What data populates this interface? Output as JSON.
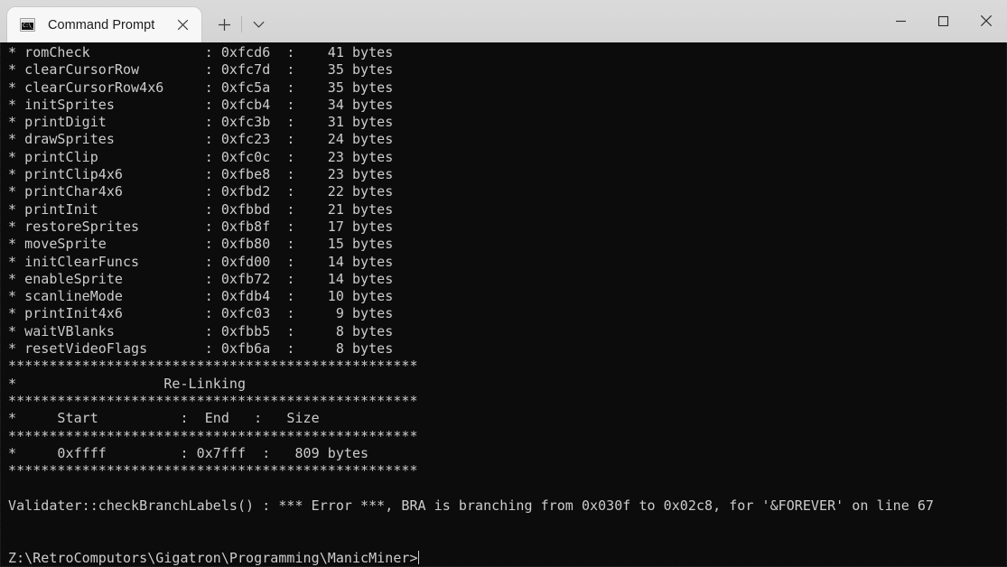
{
  "window": {
    "title": "Command Prompt",
    "controls": {
      "minimize_label": "Minimize",
      "maximize_label": "Maximize",
      "close_label": "Close"
    }
  },
  "tabbar": {
    "tabs": [
      {
        "label": "Command Prompt",
        "icon": "command-prompt-icon",
        "icon_text": "C:\\_",
        "close_label": "Close tab"
      }
    ],
    "new_tab_label": "+",
    "dropdown_label": "Open new tab dropdown"
  },
  "terminal": {
    "background": "#0c0c0c",
    "foreground": "#cccccc",
    "lines": [
      "* romCheck              : 0xfcd6  :    41 bytes",
      "* clearCursorRow        : 0xfc7d  :    35 bytes",
      "* clearCursorRow4x6     : 0xfc5a  :    35 bytes",
      "* initSprites           : 0xfcb4  :    34 bytes",
      "* printDigit            : 0xfc3b  :    31 bytes",
      "* drawSprites           : 0xfc23  :    24 bytes",
      "* printClip             : 0xfc0c  :    23 bytes",
      "* printClip4x6          : 0xfbe8  :    23 bytes",
      "* printChar4x6          : 0xfbd2  :    22 bytes",
      "* printInit             : 0xfbbd  :    21 bytes",
      "* restoreSprites        : 0xfb8f  :    17 bytes",
      "* moveSprite            : 0xfb80  :    15 bytes",
      "* initClearFuncs        : 0xfd00  :    14 bytes",
      "* enableSprite          : 0xfb72  :    14 bytes",
      "* scanlineMode          : 0xfdb4  :    10 bytes",
      "* printInit4x6          : 0xfc03  :     9 bytes",
      "* waitVBlanks           : 0xfbb5  :     8 bytes",
      "* resetVideoFlags       : 0xfb6a  :     8 bytes",
      "**************************************************",
      "*                  Re-Linking",
      "**************************************************",
      "*     Start          :  End   :   Size",
      "**************************************************",
      "*     0xffff         : 0x7fff  :   809 bytes",
      "**************************************************",
      "",
      "Validater::checkBranchLabels() : *** Error ***, BRA is branching from 0x030f to 0x02c8, for '&FOREVER' on line 67",
      "",
      ""
    ],
    "prompt": "Z:\\RetroComputors\\Gigatron\\Programming\\ManicMiner>",
    "cursor": "|"
  }
}
